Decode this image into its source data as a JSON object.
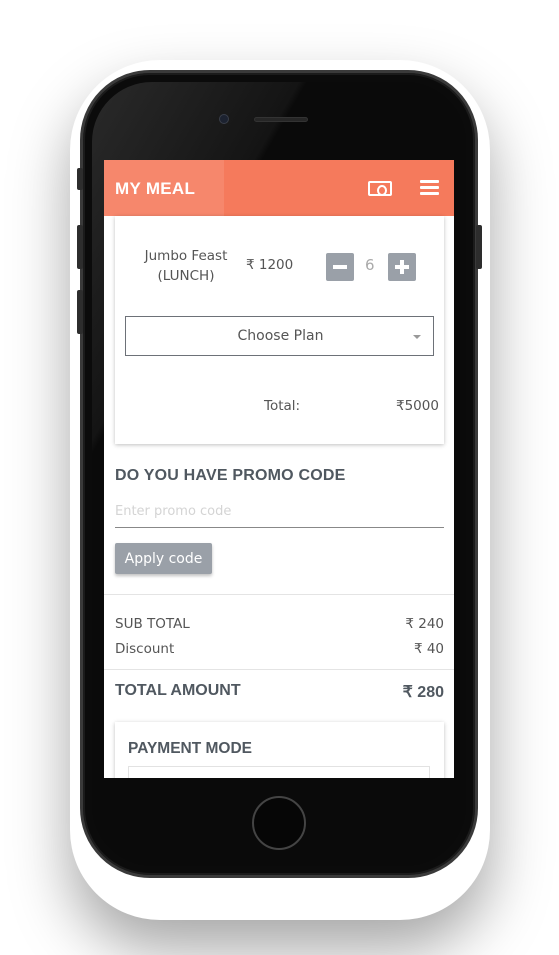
{
  "app": {
    "title": "MY MEAL"
  },
  "header": {
    "icons": [
      "cash-icon",
      "menu-icon"
    ]
  },
  "order": {
    "item_name_line1": "Jumbo Feast",
    "item_name_line2": "(LUNCH)",
    "price": "₹ 1200",
    "quantity": "6",
    "plan_select": "Choose Plan",
    "total_label": "Total:",
    "total_value": "₹5000"
  },
  "promo": {
    "heading": "DO YOU HAVE PROMO CODE",
    "placeholder": "Enter promo code",
    "value": "",
    "apply_label": "Apply code"
  },
  "summary": {
    "subtotal_label": "SUB TOTAL",
    "subtotal_value": "₹ 240",
    "discount_label": "Discount",
    "discount_value": "₹ 40",
    "total_amount_label": "TOTAL AMOUNT",
    "total_amount_value": "₹ 280"
  },
  "payment": {
    "heading": "PAYMENT MODE"
  },
  "colors": {
    "accent": "#f57a5c",
    "button_gray": "#9aa0a8",
    "heading": "#505860"
  }
}
